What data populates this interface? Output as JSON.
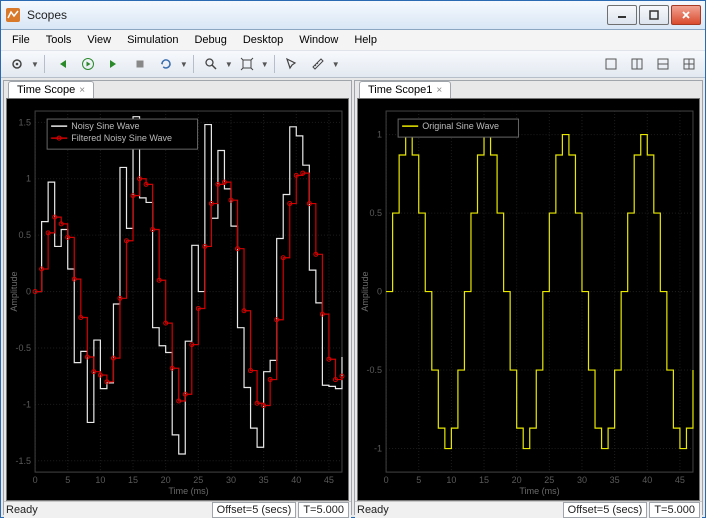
{
  "window": {
    "title": "Scopes"
  },
  "menu": [
    "File",
    "Tools",
    "View",
    "Simulation",
    "Debug",
    "Desktop",
    "Window",
    "Help"
  ],
  "panes": [
    {
      "tabLabel": "Time Scope"
    },
    {
      "tabLabel": "Time Scope1"
    }
  ],
  "status": {
    "ready": "Ready",
    "offset": "Offset=5 (secs)",
    "time": "T=5.000"
  },
  "chart_data": [
    {
      "type": "line",
      "title": "",
      "xlabel": "Time (ms)",
      "ylabel": "Amplitude",
      "xlim": [
        0,
        47
      ],
      "ylim": [
        -1.6,
        1.6
      ],
      "xticks": [
        0,
        5,
        10,
        15,
        20,
        25,
        30,
        35,
        40,
        45
      ],
      "yticks": [
        -1.5,
        -1,
        -0.5,
        0,
        0.5,
        1,
        1.5
      ],
      "legend_position": "top-left",
      "series": [
        {
          "name": "Noisy Sine Wave",
          "color": "#e8e8e8",
          "style": "step",
          "x": [
            0,
            1,
            2,
            3,
            4,
            5,
            6,
            7,
            8,
            9,
            10,
            11,
            12,
            13,
            14,
            15,
            16,
            17,
            18,
            19,
            20,
            21,
            22,
            23,
            24,
            25,
            26,
            27,
            28,
            29,
            30,
            31,
            32,
            33,
            34,
            35,
            36,
            37,
            38,
            39,
            40,
            41,
            42,
            43,
            44,
            45,
            46,
            47
          ],
          "y": [
            0.0,
            0.62,
            0.97,
            0.4,
            0.55,
            0.2,
            -0.63,
            -0.53,
            -1.16,
            -0.43,
            -0.86,
            -0.81,
            -0.11,
            1.1,
            0.56,
            1.55,
            0.83,
            0.79,
            -0.32,
            -0.48,
            -0.54,
            -1.27,
            -1.44,
            -0.44,
            0.41,
            0.0,
            1.48,
            0.65,
            1.25,
            0.91,
            0.58,
            -0.32,
            -0.85,
            -1.21,
            -1.38,
            -0.71,
            -0.61,
            0.47,
            0.86,
            1.46,
            1.38,
            1.12,
            0.19,
            -0.1,
            -0.83,
            -0.84,
            -0.86,
            -0.58
          ]
        },
        {
          "name": "Filtered Noisy Sine Wave",
          "color": "#d40000",
          "style": "step-markers",
          "x": [
            0,
            1,
            2,
            3,
            4,
            5,
            6,
            7,
            8,
            9,
            10,
            11,
            12,
            13,
            14,
            15,
            16,
            17,
            18,
            19,
            20,
            21,
            22,
            23,
            24,
            25,
            26,
            27,
            28,
            29,
            30,
            31,
            32,
            33,
            34,
            35,
            36,
            37,
            38,
            39,
            40,
            41,
            42,
            43,
            44,
            45,
            46,
            47
          ],
          "y": [
            0.0,
            0.2,
            0.52,
            0.66,
            0.6,
            0.48,
            0.11,
            -0.23,
            -0.58,
            -0.71,
            -0.74,
            -0.8,
            -0.59,
            -0.06,
            0.45,
            0.85,
            1.0,
            0.95,
            0.55,
            0.1,
            -0.28,
            -0.68,
            -0.97,
            -0.91,
            -0.47,
            -0.15,
            0.4,
            0.78,
            0.95,
            0.97,
            0.81,
            0.38,
            -0.17,
            -0.7,
            -0.99,
            -1.01,
            -0.78,
            -0.25,
            0.3,
            0.78,
            1.03,
            1.05,
            0.78,
            0.33,
            -0.2,
            -0.6,
            -0.78,
            -0.75
          ]
        }
      ]
    },
    {
      "type": "line",
      "title": "",
      "xlabel": "Time (ms)",
      "ylabel": "Amplitude",
      "xlim": [
        0,
        47
      ],
      "ylim": [
        -1.15,
        1.15
      ],
      "xticks": [
        0,
        5,
        10,
        15,
        20,
        25,
        30,
        35,
        40,
        45
      ],
      "yticks": [
        -1,
        -0.5,
        0,
        0.5,
        1
      ],
      "legend_position": "top-left",
      "series": [
        {
          "name": "Original Sine Wave",
          "color": "#e8e800",
          "style": "step",
          "x": [
            0,
            1,
            2,
            3,
            4,
            5,
            6,
            7,
            8,
            9,
            10,
            11,
            12,
            13,
            14,
            15,
            16,
            17,
            18,
            19,
            20,
            21,
            22,
            23,
            24,
            25,
            26,
            27,
            28,
            29,
            30,
            31,
            32,
            33,
            34,
            35,
            36,
            37,
            38,
            39,
            40,
            41,
            42,
            43,
            44,
            45,
            46,
            47
          ],
          "y": [
            0.0,
            0.5,
            0.87,
            1.0,
            0.87,
            0.5,
            0.0,
            -0.5,
            -0.87,
            -1.0,
            -0.87,
            -0.5,
            0.0,
            0.5,
            0.87,
            1.0,
            0.87,
            0.5,
            0.0,
            -0.5,
            -0.87,
            -1.0,
            -0.87,
            -0.5,
            0.0,
            0.5,
            0.87,
            1.0,
            0.87,
            0.5,
            0.0,
            -0.5,
            -0.87,
            -1.0,
            -0.87,
            -0.5,
            0.0,
            0.5,
            0.87,
            1.0,
            0.87,
            0.5,
            0.0,
            -0.5,
            -0.87,
            -1.0,
            -0.87,
            -0.5
          ]
        }
      ]
    }
  ]
}
